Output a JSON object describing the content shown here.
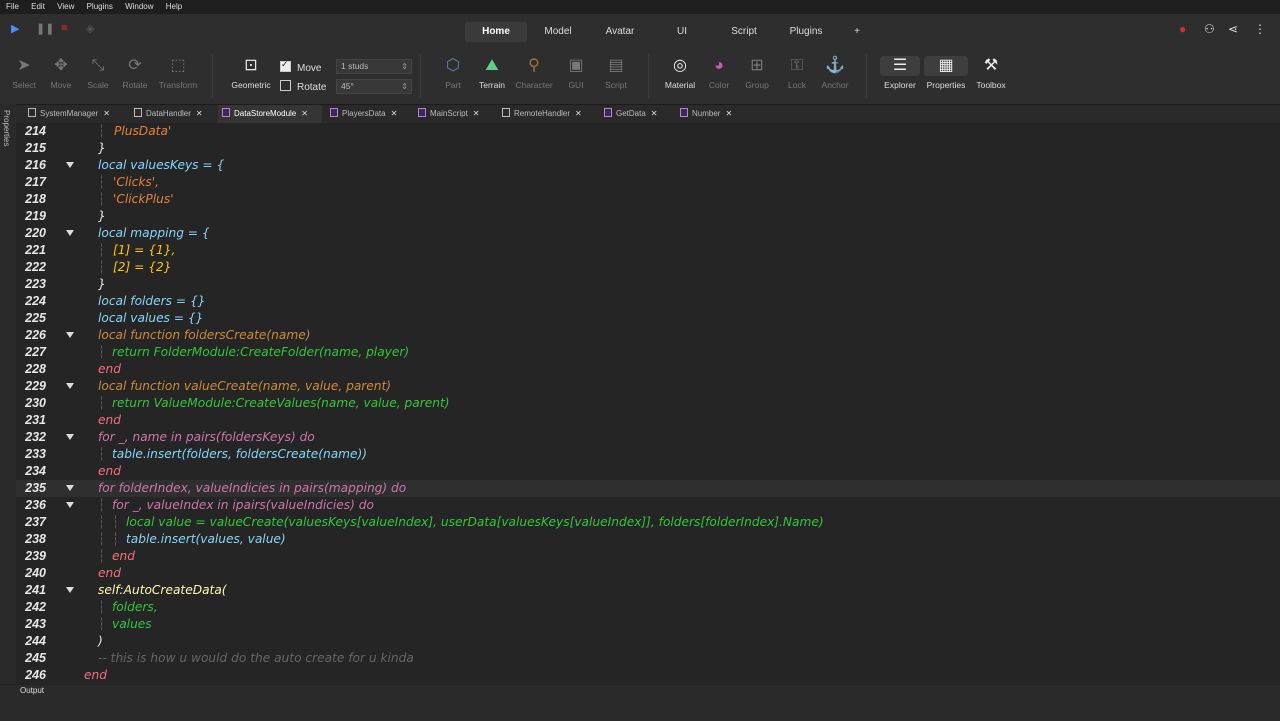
{
  "menu": [
    "File",
    "Edit",
    "View",
    "Plugins",
    "Window",
    "Help"
  ],
  "top_tabs": [
    {
      "label": "Home",
      "active": true
    },
    {
      "label": "Model",
      "active": false
    },
    {
      "label": "Avatar",
      "active": false
    },
    {
      "label": "UI",
      "active": false
    },
    {
      "label": "Script",
      "active": false
    },
    {
      "label": "Plugins",
      "active": false
    }
  ],
  "add_tab_label": "+",
  "tools": {
    "select": "Select",
    "move": "Move",
    "scale": "Scale",
    "rotate": "Rotate",
    "transform": "Transform",
    "geometric": "Geometric",
    "part": "Part",
    "terrain": "Terrain",
    "character": "Character",
    "gui": "GUI",
    "script": "Script",
    "material": "Material",
    "color": "Color",
    "group": "Group",
    "lock": "Lock",
    "anchor": "Anchor",
    "explorer": "Explorer",
    "properties": "Properties",
    "toolbox": "Toolbox"
  },
  "snap": {
    "move_label": "Move",
    "move_checked": true,
    "move_value": "1 studs",
    "rotate_label": "Rotate",
    "rotate_checked": false,
    "rotate_value": "45°"
  },
  "side_panel_label": "Properties",
  "file_tabs": [
    {
      "name": "SystemManager",
      "active": false
    },
    {
      "name": "DataHandler",
      "active": false
    },
    {
      "name": "DataStoreModule",
      "active": true
    },
    {
      "name": "PlayersData",
      "active": false
    },
    {
      "name": "MainScript",
      "active": false
    },
    {
      "name": "RemoteHandler",
      "active": false
    },
    {
      "name": "GetData",
      "active": false
    },
    {
      "name": "Number",
      "active": false
    }
  ],
  "code_lines": [
    {
      "n": "214",
      "t": "PlusData'"
    },
    {
      "n": "215",
      "t": "}"
    },
    {
      "n": "216",
      "t": "local valuesKeys = {"
    },
    {
      "n": "217",
      "t": "'Clicks',"
    },
    {
      "n": "218",
      "t": "'ClickPlus'"
    },
    {
      "n": "219",
      "t": "}"
    },
    {
      "n": "220",
      "t": "local mapping = {"
    },
    {
      "n": "221",
      "t": "[1] = {1},"
    },
    {
      "n": "222",
      "t": "[2] = {2}"
    },
    {
      "n": "223",
      "t": "}"
    },
    {
      "n": "224",
      "t": "local folders = {}"
    },
    {
      "n": "225",
      "t": "local values = {}"
    },
    {
      "n": "226",
      "t": "local function foldersCreate(name)"
    },
    {
      "n": "227",
      "t": "return FolderModule:CreateFolder(name, player)"
    },
    {
      "n": "228",
      "t": "end"
    },
    {
      "n": "229",
      "t": "local function valueCreate(name, value, parent)"
    },
    {
      "n": "230",
      "t": "return ValueModule:CreateValues(name, value, parent)"
    },
    {
      "n": "231",
      "t": "end"
    },
    {
      "n": "232",
      "t": "for _, name in pairs(foldersKeys) do"
    },
    {
      "n": "233",
      "t": "table.insert(folders, foldersCreate(name))"
    },
    {
      "n": "234",
      "t": "end"
    },
    {
      "n": "235",
      "t": "for folderIndex, valueIndicies in pairs(mapping) do"
    },
    {
      "n": "236",
      "t": "for _, valueIndex in ipairs(valueIndicies) do"
    },
    {
      "n": "237",
      "t": "local value = valueCreate(valuesKeys[valueIndex], userData[valuesKeys[valueIndex]], folders[folderIndex].Name)"
    },
    {
      "n": "238",
      "t": "table.insert(values, value)"
    },
    {
      "n": "239",
      "t": "end"
    },
    {
      "n": "240",
      "t": "end"
    },
    {
      "n": "241",
      "t": "self:AutoCreateData("
    },
    {
      "n": "242",
      "t": "folders,"
    },
    {
      "n": "243",
      "t": "values"
    },
    {
      "n": "244",
      "t": ")"
    },
    {
      "n": "245",
      "t": "-- this is how u would do the auto create for u kinda"
    },
    {
      "n": "246",
      "t": "end"
    }
  ],
  "bottom_panel_label": "Output"
}
